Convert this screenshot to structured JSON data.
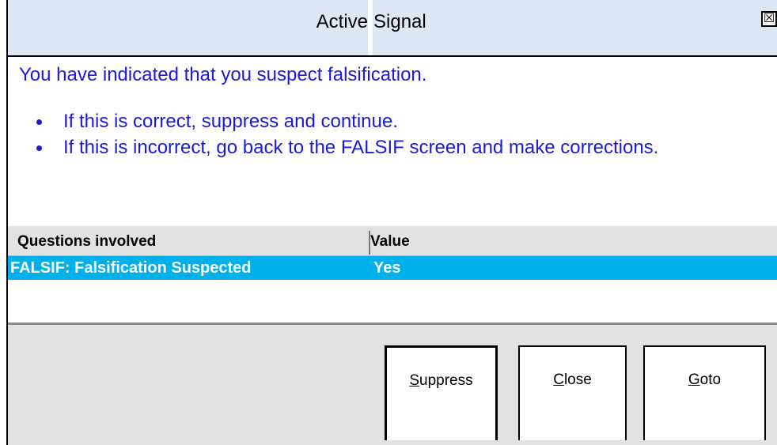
{
  "window": {
    "title_left": "Active",
    "title_right": "Signal",
    "close_glyph": "☒"
  },
  "message": {
    "intro": "You have indicated that you suspect falsification.",
    "bullets": [
      "If this is correct, suppress and continue.",
      "If this is incorrect, go back to the FALSIF screen and make corrections."
    ]
  },
  "grid": {
    "columns": [
      "Questions involved",
      "Value"
    ],
    "rows": [
      {
        "question": "FALSIF: Falsification Suspected",
        "value": "Yes"
      }
    ]
  },
  "buttons": {
    "suppress": {
      "mnemonic": "S",
      "rest": "uppress"
    },
    "close": {
      "mnemonic": "C",
      "rest": "lose"
    },
    "goto": {
      "mnemonic": "G",
      "rest": "oto"
    }
  },
  "colors": {
    "title_bg": "#dde8f5",
    "message_text": "#1a1ad8",
    "selected_row": "#00b0eb",
    "footer_bg": "#e2e2e2"
  }
}
